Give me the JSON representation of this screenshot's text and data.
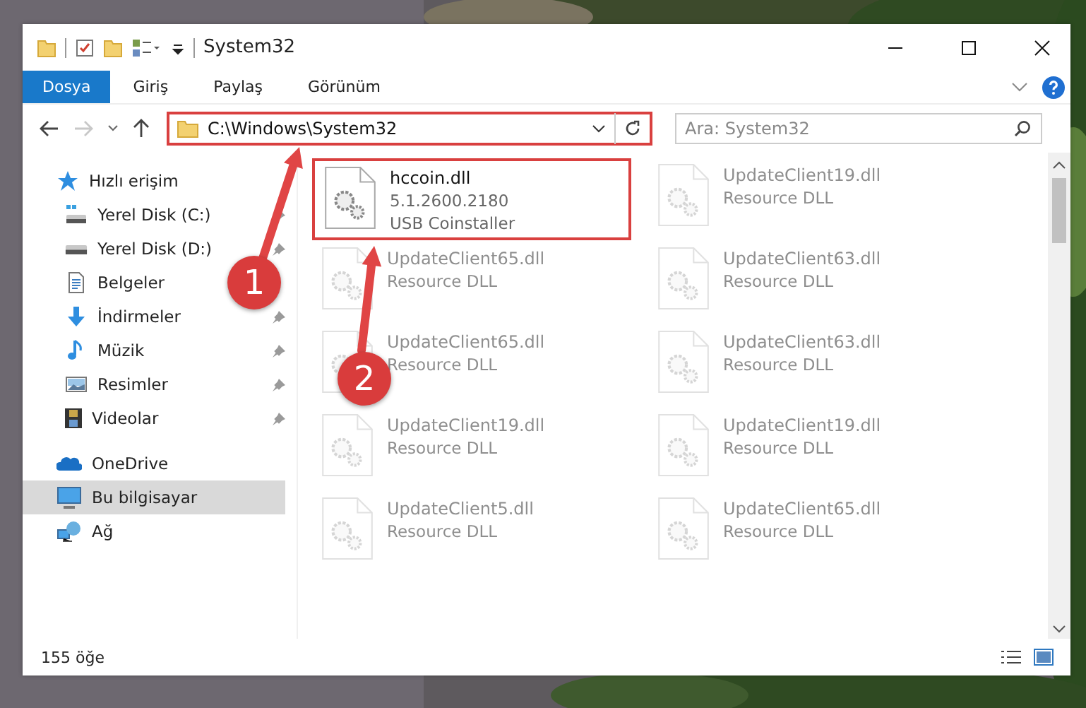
{
  "window": {
    "title": "System32"
  },
  "ribbon_tabs": [
    {
      "label": "Dosya",
      "selected": true
    },
    {
      "label": "Giriş",
      "selected": false
    },
    {
      "label": "Paylaş",
      "selected": false
    },
    {
      "label": "Görünüm",
      "selected": false
    }
  ],
  "address": {
    "path": "C:\\Windows\\System32",
    "highlighted": true
  },
  "search": {
    "placeholder": "Ara: System32"
  },
  "sidebar": {
    "items": [
      {
        "label": "Hızlı erişim",
        "kind": "star",
        "pinned": false,
        "selected": false,
        "children": [
          {
            "label": "Yerel Disk (C:)",
            "kind": "drive-c",
            "pinned": true,
            "selected": false
          },
          {
            "label": "Yerel Disk (D:)",
            "kind": "drive",
            "pinned": true,
            "selected": false
          },
          {
            "label": "Belgeler",
            "kind": "doc",
            "pinned": false,
            "selected": false
          },
          {
            "label": "İndirmeler",
            "kind": "download",
            "pinned": true,
            "selected": false
          },
          {
            "label": "Müzik",
            "kind": "music",
            "pinned": true,
            "selected": false
          },
          {
            "label": "Resimler",
            "kind": "pictures",
            "pinned": true,
            "selected": false
          },
          {
            "label": "Videolar",
            "kind": "video",
            "pinned": true,
            "selected": false
          }
        ]
      },
      {
        "label": "OneDrive",
        "kind": "cloud",
        "pinned": false,
        "selected": false
      },
      {
        "label": "Bu bilgisayar",
        "kind": "pc",
        "pinned": false,
        "selected": true
      },
      {
        "label": "Ağ",
        "kind": "network",
        "pinned": false,
        "selected": false
      }
    ]
  },
  "files": [
    {
      "name": "hccoin.dll",
      "lines": [
        "5.1.2600.2180",
        "USB Coinstaller"
      ],
      "highlighted": true,
      "blurred": false
    },
    {
      "name": "UpdateClient19.dll",
      "lines": [
        "Resource DLL"
      ],
      "highlighted": false,
      "blurred": true
    },
    {
      "name": "UpdateClient65.dll",
      "lines": [
        "Resource DLL"
      ],
      "highlighted": false,
      "blurred": true
    },
    {
      "name": "UpdateClient63.dll",
      "lines": [
        "Resource DLL"
      ],
      "highlighted": false,
      "blurred": true
    },
    {
      "name": "UpdateClient65.dll",
      "lines": [
        "Resource DLL"
      ],
      "highlighted": false,
      "blurred": true
    },
    {
      "name": "UpdateClient63.dll",
      "lines": [
        "Resource DLL"
      ],
      "highlighted": false,
      "blurred": true
    },
    {
      "name": "UpdateClient19.dll",
      "lines": [
        "Resource DLL"
      ],
      "highlighted": false,
      "blurred": true
    },
    {
      "name": "UpdateClient19.dll",
      "lines": [
        "Resource DLL"
      ],
      "highlighted": false,
      "blurred": true
    },
    {
      "name": "UpdateClient5.dll",
      "lines": [
        "Resource DLL"
      ],
      "highlighted": false,
      "blurred": true
    },
    {
      "name": "UpdateClient65.dll",
      "lines": [
        "Resource DLL"
      ],
      "highlighted": false,
      "blurred": true
    }
  ],
  "status_bar": {
    "count": "155 öğe"
  },
  "callouts": [
    {
      "number": "1"
    },
    {
      "number": "2"
    }
  ]
}
